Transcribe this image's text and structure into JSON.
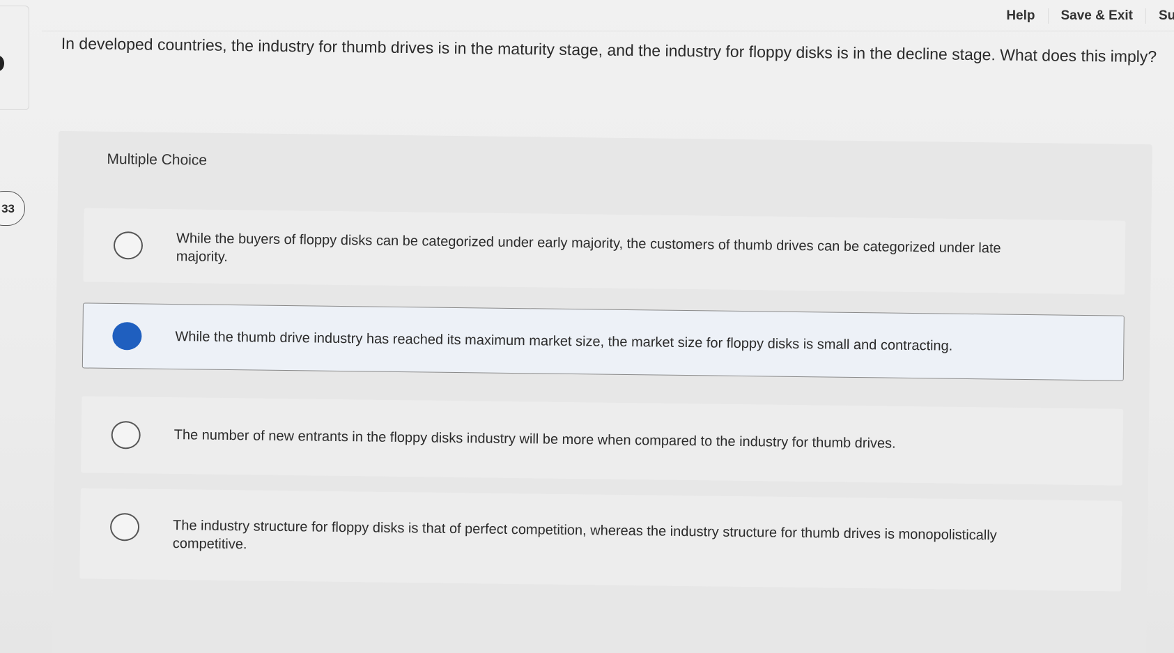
{
  "nav": {
    "help": "Help",
    "save_exit": "Save & Exit",
    "submit_partial": "Su"
  },
  "question": {
    "number": "33",
    "text": "In developed countries, the industry for thumb drives is in the maturity stage, and the industry for floppy disks is in the decline stage. What does this imply?"
  },
  "multiple_choice": {
    "heading": "Multiple Choice",
    "selected_index": 1,
    "options": [
      {
        "text": "While the buyers of floppy disks can be categorized under early majority, the customers of thumb drives can be categorized under late majority."
      },
      {
        "text": "While the thumb drive industry has reached its maximum market size, the market size for floppy disks is small and contracting."
      },
      {
        "text": "The number of new entrants in the floppy disks industry will be more when compared to the industry for thumb drives."
      },
      {
        "text": "The industry structure for floppy disks is that of perfect competition, whereas the industry structure for thumb drives is monopolistically competitive."
      }
    ]
  },
  "colors": {
    "selected_radio": "#1f5fbf",
    "selected_background": "#edf1f7"
  }
}
